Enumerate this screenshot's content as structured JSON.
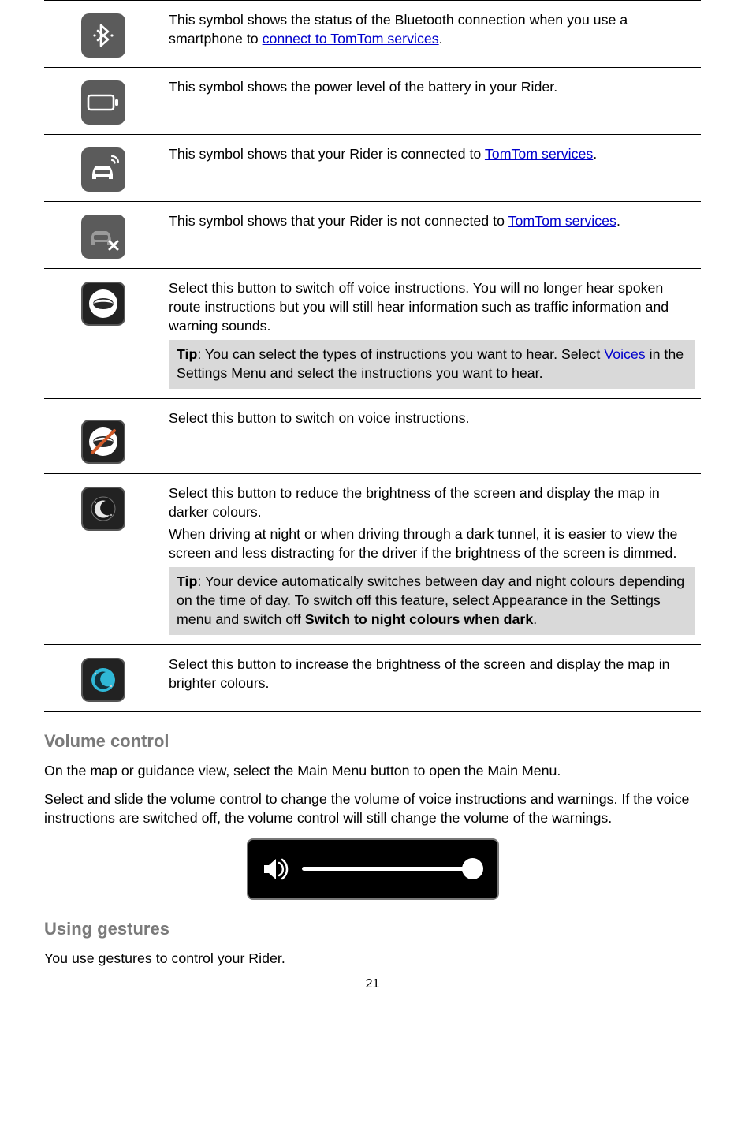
{
  "rows": [
    {
      "desc_pre": "This symbol shows the status of the Bluetooth connection when you use a smartphone to ",
      "link": "connect to TomTom services",
      "desc_post": "."
    },
    {
      "desc": "This symbol shows the power level of the battery in your Rider."
    },
    {
      "desc_pre": "This symbol shows that your Rider is connected to ",
      "link": "TomTom services",
      "desc_post": "."
    },
    {
      "desc_pre": "This symbol shows that your Rider is not connected to ",
      "link": "TomTom services",
      "desc_post": "."
    },
    {
      "desc": "Select this button to switch off voice instructions. You will no longer hear spoken route instructions but you will still hear information such as traffic information and warning sounds.",
      "tip_label": "Tip",
      "tip_pre": ": You can select the types of instructions you want to hear. Select ",
      "tip_link": "Voices",
      "tip_post": " in the Settings Menu and select the instructions you want to hear."
    },
    {
      "desc": "Select this button to switch on voice instructions."
    },
    {
      "desc": "Select this button to reduce the brightness of the screen and display the map in darker colours.",
      "desc2": "When driving at night or when driving through a dark tunnel, it is easier to view the screen and less distracting for the driver if the brightness of the screen is dimmed.",
      "tip_label": "Tip",
      "tip_pre": ": Your device automatically switches between day and night colours depending on the time of day. To switch off this feature, select Appearance in the Settings menu and switch off ",
      "tip_bold": "Switch to night colours when dark",
      "tip_post": "."
    },
    {
      "desc": "Select this button to increase the brightness of the screen and display the map in brighter colours."
    }
  ],
  "sections": {
    "volume_title": "Volume control",
    "volume_p1": "On the map or guidance view, select the Main Menu button to open the Main Menu.",
    "volume_p2": "Select and slide the volume control to change the volume of voice instructions and warnings. If the voice instructions are switched off, the volume control will still change the volume of the warnings.",
    "gestures_title": "Using gestures",
    "gestures_p1": "You use gestures to control your Rider."
  },
  "page_number": "21"
}
